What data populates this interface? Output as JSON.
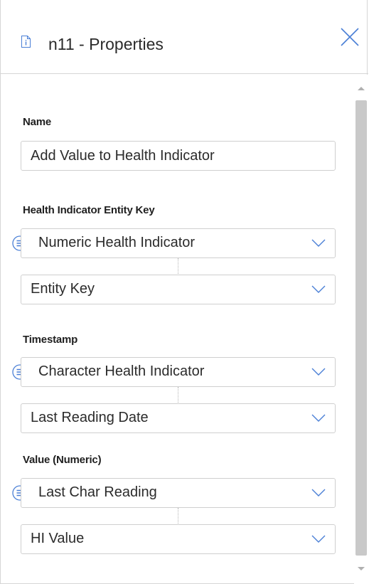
{
  "header": {
    "title": "n11 - Properties",
    "icon": "document-info-icon",
    "close_icon": "close-icon"
  },
  "form": {
    "name": {
      "label": "Name",
      "value": "Add Value to Health Indicator"
    },
    "entity_key": {
      "label": "Health Indicator Entity Key",
      "source": "Numeric Health Indicator",
      "field": "Entity Key"
    },
    "timestamp": {
      "label": "Timestamp",
      "source": "Character Health Indicator",
      "field": "Last Reading Date"
    },
    "value_numeric": {
      "label": "Value (Numeric)",
      "source": "Last Char Reading",
      "field": "HI Value"
    }
  },
  "colors": {
    "accent": "#4a7fd6",
    "border": "#cfcfcf",
    "scroll_thumb": "#c9c9c9"
  }
}
